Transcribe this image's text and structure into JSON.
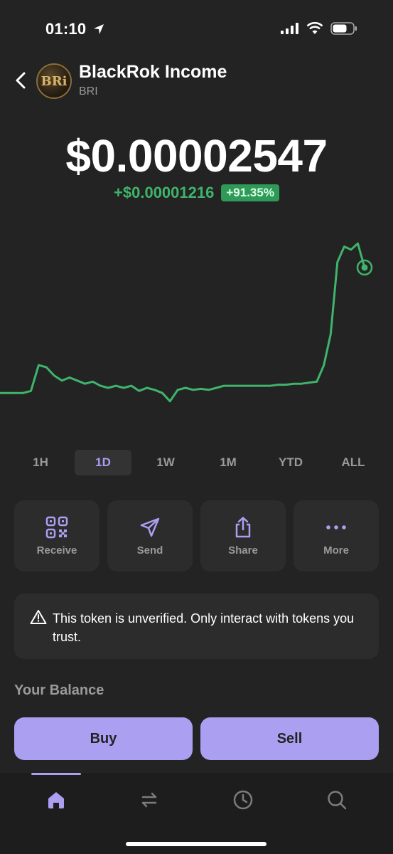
{
  "status": {
    "time": "01:10"
  },
  "token": {
    "name": "BlackRok Income",
    "symbol": "BRI",
    "logo_text": "BRi"
  },
  "price": {
    "value": "$0.00002547",
    "change_abs": "+$0.00001216",
    "change_pct": "+91.35%"
  },
  "chart_data": {
    "type": "line",
    "series": [
      {
        "values": [
          1.33,
          1.33,
          1.33,
          1.33,
          1.35,
          1.6,
          1.58,
          1.5,
          1.45,
          1.48,
          1.45,
          1.42,
          1.44,
          1.4,
          1.38,
          1.4,
          1.38,
          1.4,
          1.35,
          1.38,
          1.36,
          1.33,
          1.25,
          1.36,
          1.38,
          1.36,
          1.37,
          1.36,
          1.38,
          1.4,
          1.4,
          1.4,
          1.4,
          1.4,
          1.4,
          1.4,
          1.41,
          1.41,
          1.42,
          1.42,
          1.43,
          1.44,
          1.6,
          1.9,
          2.6,
          2.75,
          2.72,
          2.78,
          2.547
        ]
      }
    ],
    "color": "#3fb46b"
  },
  "time_ranges": {
    "items": [
      {
        "label": "1H"
      },
      {
        "label": "1D"
      },
      {
        "label": "1W"
      },
      {
        "label": "1M"
      },
      {
        "label": "YTD"
      },
      {
        "label": "ALL"
      }
    ],
    "selected": "1D"
  },
  "actions": {
    "receive": "Receive",
    "send": "Send",
    "share": "Share",
    "more": "More"
  },
  "warning": {
    "text": "This token is unverified. Only interact with tokens you trust."
  },
  "balance": {
    "label": "Your Balance"
  },
  "trade": {
    "buy": "Buy",
    "sell": "Sell"
  },
  "colors": {
    "accent": "#ab9ff2",
    "positive": "#3fb46b",
    "background": "#232323",
    "card": "#2c2c2c"
  },
  "tabs": [
    {
      "icon": "home-icon",
      "active": true
    },
    {
      "icon": "swap-icon",
      "active": false
    },
    {
      "icon": "history-icon",
      "active": false
    },
    {
      "icon": "search-icon",
      "active": false
    }
  ]
}
